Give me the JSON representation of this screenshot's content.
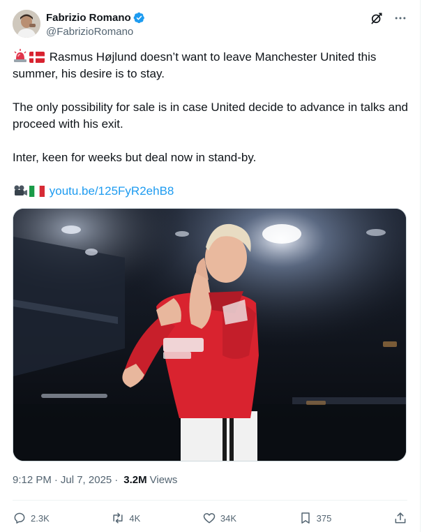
{
  "author": {
    "name": "Fabrizio Romano",
    "handle": "@FabrizioRomano"
  },
  "tweet": {
    "line1": "Rasmus Højlund doesn’t want to leave Manchester United this summer, his desire is to stay.",
    "line2": "The only possibility for sale is in case United decide to advance in talks and proceed with his exit.",
    "line3": "Inter, keen for weeks but deal now in stand-by.",
    "link_text": "youtu.be/125FyR2ehB8"
  },
  "meta": {
    "time": "9:12 PM",
    "separator": "·",
    "date": "Jul 7, 2025",
    "views_count": "3.2M",
    "views_label": "Views"
  },
  "actions": {
    "replies": "2.3K",
    "reposts": "4K",
    "likes": "34K",
    "bookmarks": "375"
  },
  "colors": {
    "accent": "#1d9bf0",
    "text": "#0f1419",
    "secondary": "#536471",
    "divider": "#eff3f4"
  },
  "icons": {
    "verified": "verified-badge-icon",
    "grok": "grok-icon",
    "more": "more-icon",
    "reply": "reply-icon",
    "repost": "repost-icon",
    "like": "heart-icon",
    "bookmark": "bookmark-icon",
    "share": "share-icon"
  }
}
